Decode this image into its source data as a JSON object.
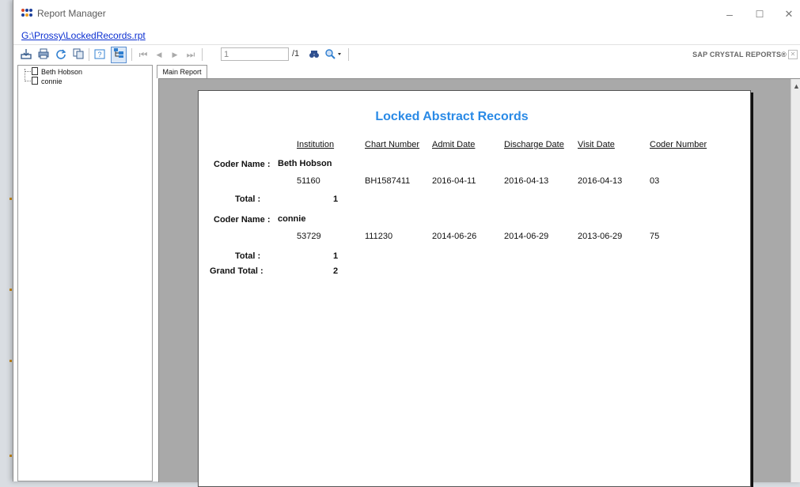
{
  "window": {
    "title": "Report Manager",
    "minimize": "–",
    "maximize": "☐",
    "close": "✕"
  },
  "report_path": "G:\\Prossy\\LockedRecords.rpt",
  "toolbar": {
    "page_current": "1",
    "page_total": "/1",
    "brand": "SAP CRYSTAL REPORTS®",
    "icons": [
      "export-icon",
      "print-icon",
      "refresh-icon",
      "copy-icon",
      "help-icon",
      "group-tree-icon",
      "first-page-icon",
      "prev-page-icon",
      "next-page-icon",
      "last-page-icon",
      "find-icon",
      "zoom-icon"
    ]
  },
  "group_tree": {
    "items": [
      {
        "label": "Beth Hobson"
      },
      {
        "label": "connie"
      }
    ]
  },
  "tabs": {
    "main": "Main Report"
  },
  "report": {
    "title": "Locked Abstract Records",
    "columns": [
      "Institution",
      "Chart Number",
      "Admit Date",
      "Discharge Date",
      "Visit Date",
      "Coder Number"
    ],
    "groups": [
      {
        "label": "Coder Name :",
        "name": "Beth Hobson",
        "rows": [
          {
            "institution": "51160",
            "chart": "BH1587411",
            "admit": "2016-04-11",
            "discharge": "2016-04-13",
            "visit": "2016-04-13",
            "coder": "03"
          }
        ],
        "total_label": "Total :",
        "total": "1"
      },
      {
        "label": "Coder Name :",
        "name": "connie",
        "rows": [
          {
            "institution": "53729",
            "chart": "111230",
            "admit": "2014-06-26",
            "discharge": "2014-06-29",
            "visit": "2013-06-29",
            "coder": "75"
          }
        ],
        "total_label": "Total :",
        "total": "1"
      }
    ],
    "grand_total_label": "Grand Total :",
    "grand_total": "2"
  },
  "colors": {
    "title_blue": "#2a8ae6",
    "link": "#0b2fd1",
    "viewer_bg": "#a9a9a9"
  }
}
